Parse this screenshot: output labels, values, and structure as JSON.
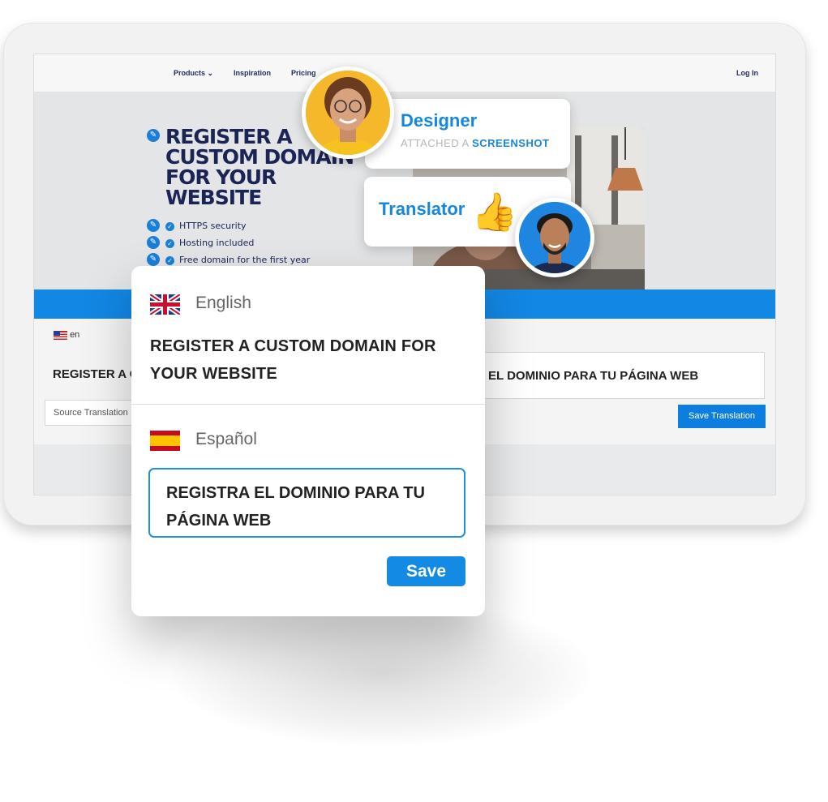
{
  "site_nav": {
    "products": "Products",
    "inspiration": "Inspiration",
    "pricing": "Pricing",
    "login": "Log In"
  },
  "hero": {
    "title": "REGISTER A\nCUSTOM DOMAIN\nFOR YOUR\nWEBSITE",
    "features": [
      "HTTPS security",
      "Hosting included",
      "Free domain for the first year"
    ]
  },
  "editor": {
    "source_lang_code": "en",
    "source_text_truncated": "REGISTER A C",
    "source_tab": "Source Translation",
    "target_text_partial": "EL DOMINIO PARA TU PÁGINA WEB",
    "save_translation": "Save Translation"
  },
  "designer_badge": {
    "role": "Designer",
    "action": "ATTACHED A",
    "object": "SCREENSHOT"
  },
  "translator_badge": {
    "role": "Translator",
    "emoji": "👍"
  },
  "panel": {
    "source_language": "English",
    "source_text": "REGISTER A CUSTOM DOMAIN FOR YOUR WEBSITE",
    "target_language": "Español",
    "target_text": "REGISTRA EL DOMINIO PARA TU PÁGINA WEB",
    "save_label": "Save"
  },
  "colors": {
    "accent_blue": "#1587de",
    "navy": "#1a2455",
    "input_border": "#1f8ee6"
  }
}
